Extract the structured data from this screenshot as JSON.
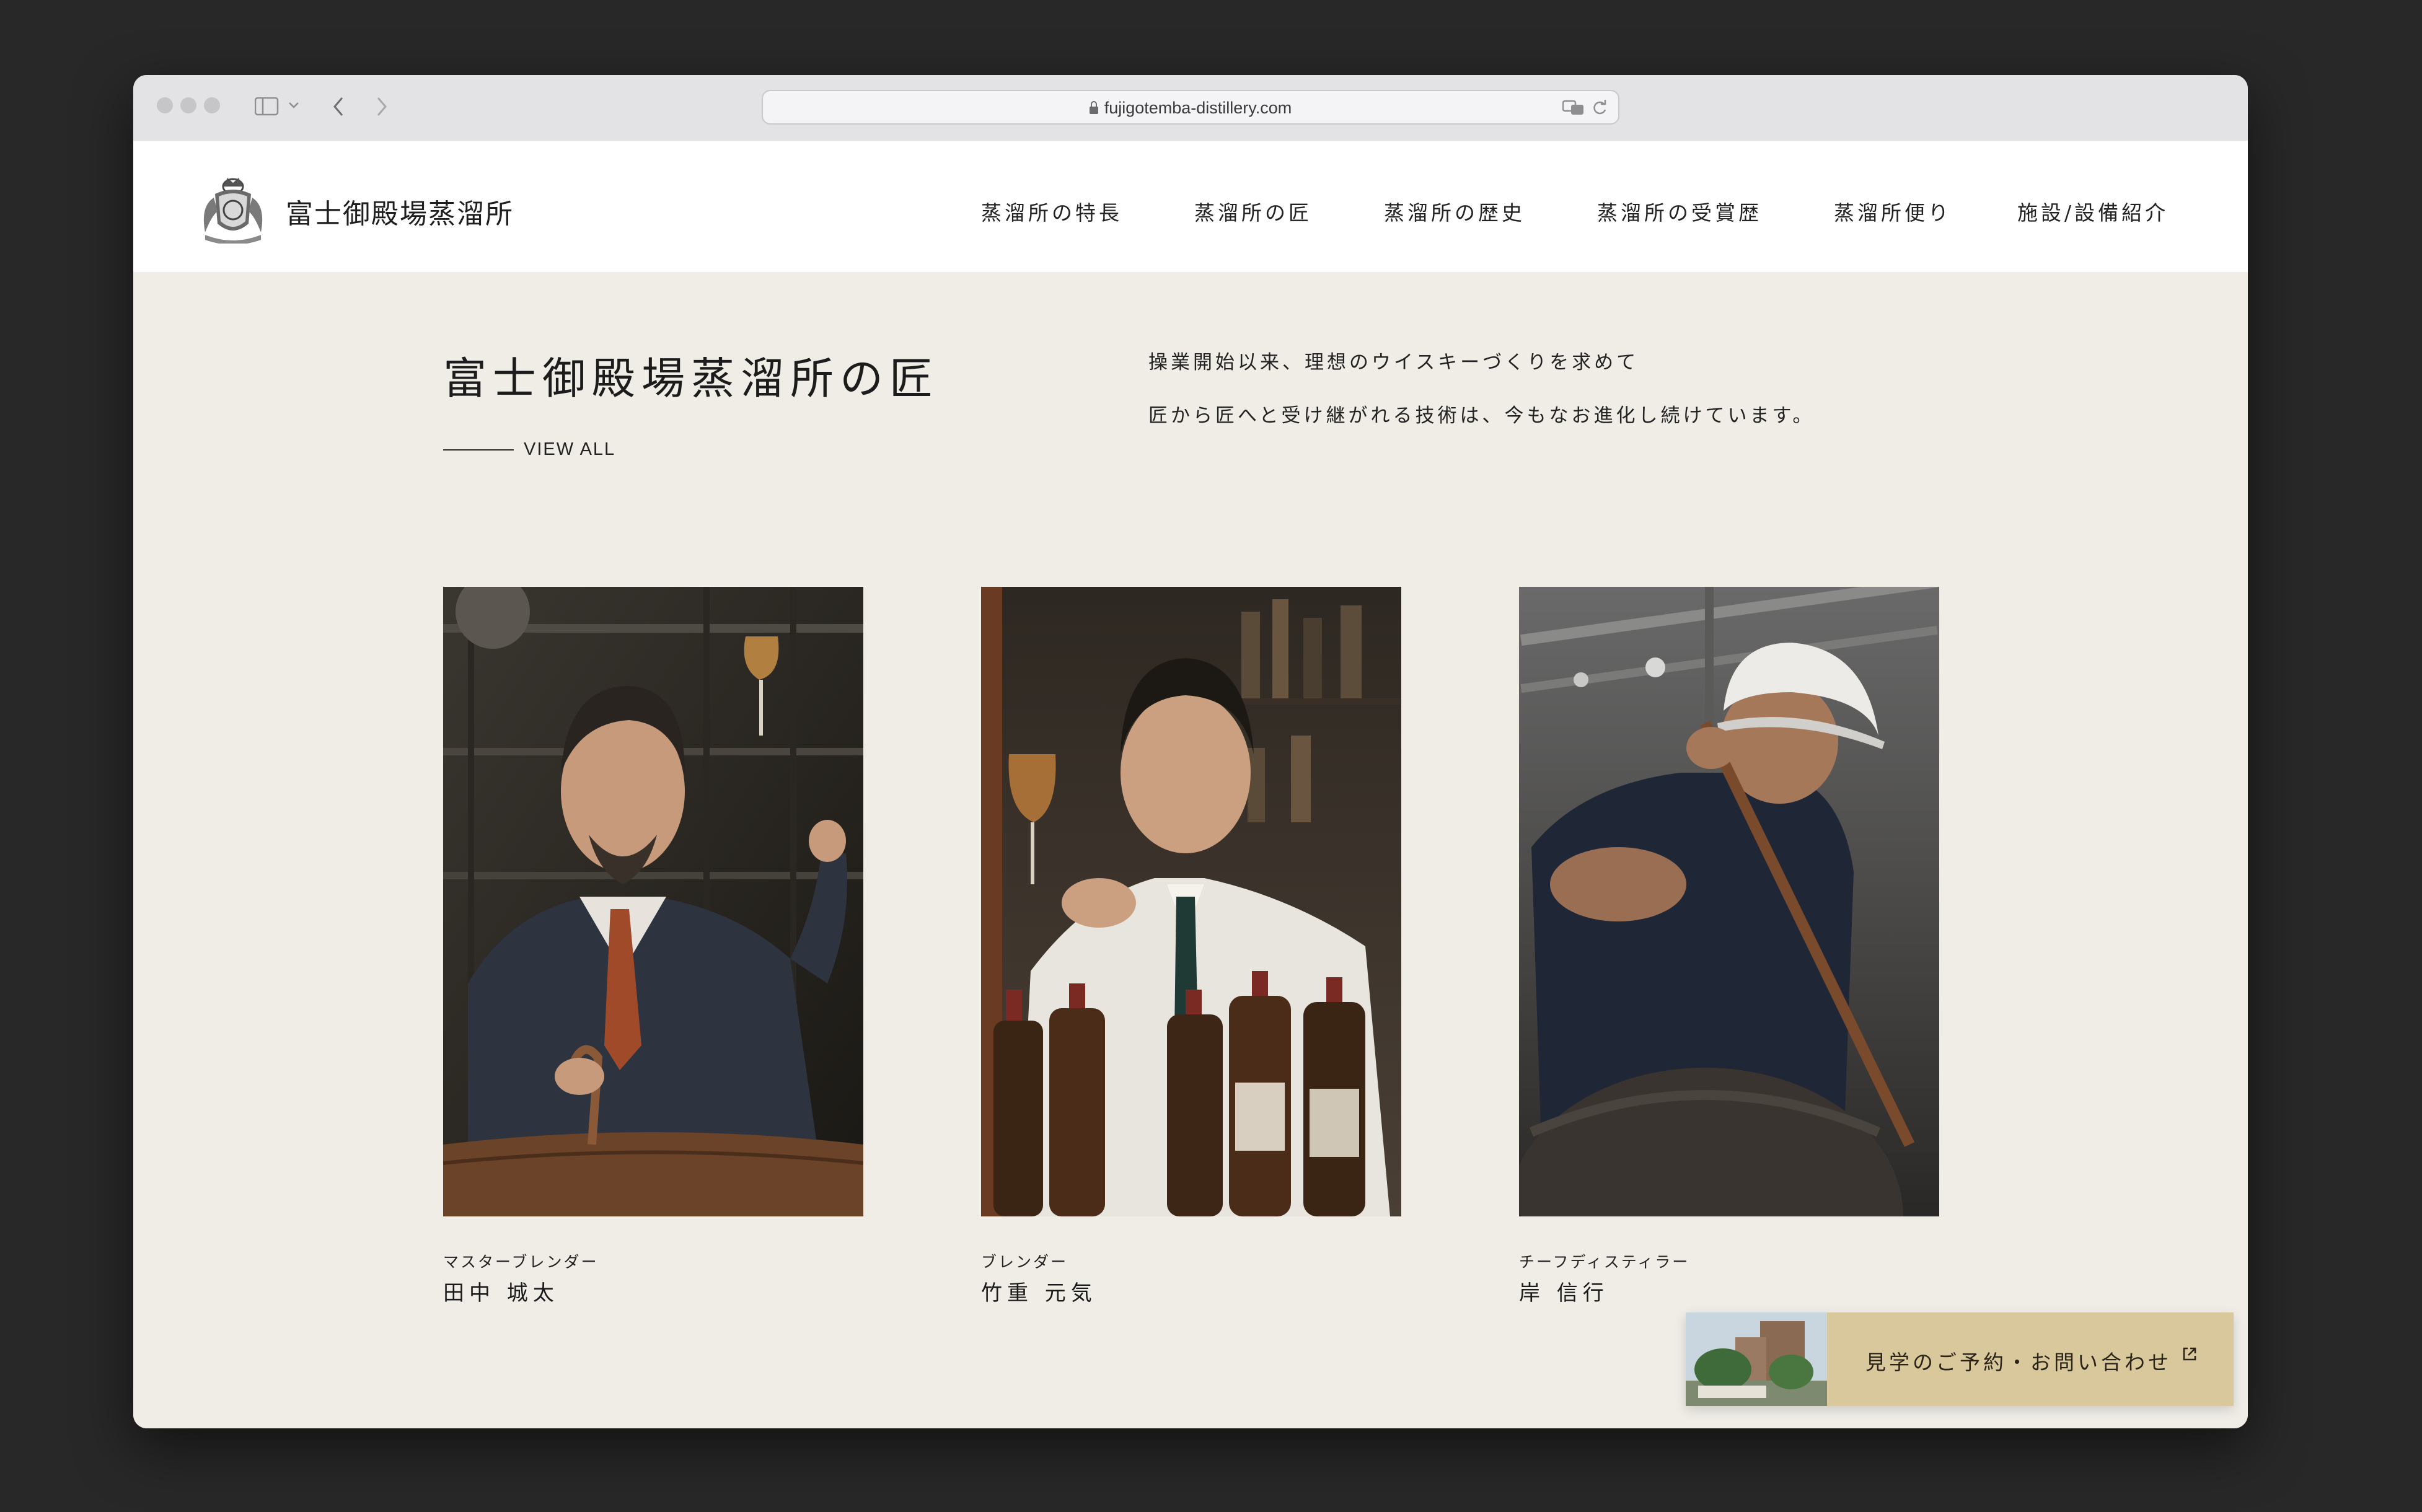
{
  "browser": {
    "url": "fujigotemba-distillery.com"
  },
  "site": {
    "logo_text": "富士御殿場蒸溜所",
    "nav": [
      {
        "label": "蒸溜所の特長"
      },
      {
        "label": "蒸溜所の匠"
      },
      {
        "label": "蒸溜所の歴史"
      },
      {
        "label": "蒸溜所の受賞歴"
      },
      {
        "label": "蒸溜所便り"
      },
      {
        "label": "施設/設備紹介"
      }
    ]
  },
  "section": {
    "title": "富士御殿場蒸溜所の匠",
    "view_all": "VIEW ALL",
    "lead_line1": "操業開始以来、理想のウイスキーづくりを求めて",
    "lead_line2": "匠から匠へと受け継がれる技術は、今もなお進化し続けています。"
  },
  "masters": [
    {
      "role": "マスターブレンダー",
      "name": "田中 城太"
    },
    {
      "role": "ブレンダー",
      "name": "竹重 元気"
    },
    {
      "role": "チーフディスティラー",
      "name": "岸 信行"
    }
  ],
  "cta": {
    "label": "見学のご予約・お問い合わせ"
  },
  "colors": {
    "page_background": "#f0ede7",
    "cta_background": "#d8c89c",
    "text": "#222222"
  }
}
